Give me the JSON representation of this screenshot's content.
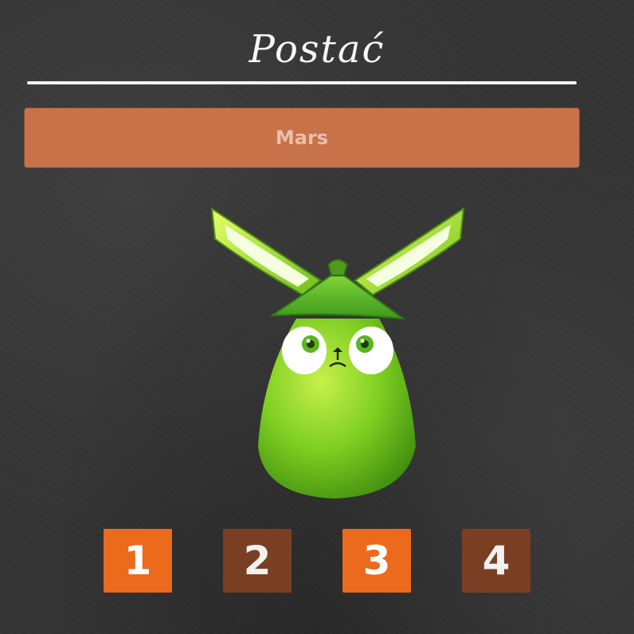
{
  "header": {
    "title": "Postać"
  },
  "character": {
    "name": "Mars"
  },
  "selector": {
    "options": [
      {
        "label": "1",
        "state": "active"
      },
      {
        "label": "2",
        "state": "inactive"
      },
      {
        "label": "3",
        "state": "active"
      },
      {
        "label": "4",
        "state": "inactive"
      }
    ]
  },
  "colors": {
    "name_field": "#c8724a",
    "button_active": "#ec6a1c",
    "button_inactive": "#7a3f22",
    "character_body": "#7ac81f"
  }
}
